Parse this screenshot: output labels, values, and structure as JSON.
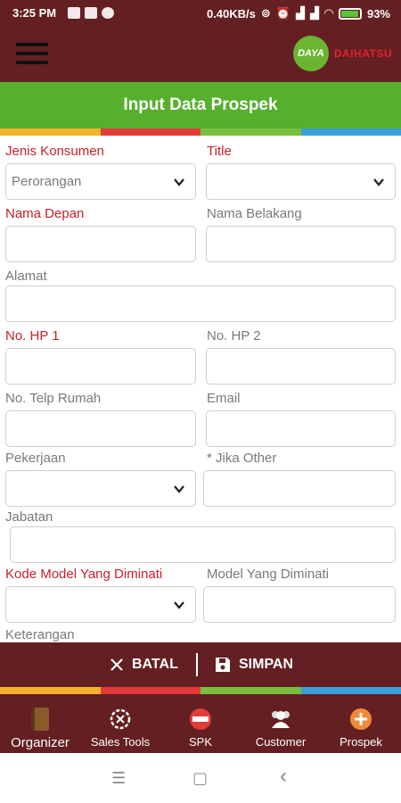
{
  "status": {
    "time": "3:25 PM",
    "net_speed": "0.40KB/s",
    "battery": "93%",
    "icons": [
      "notification-icon",
      "image-icon",
      "chat-icon",
      "sync-icon",
      "alarm-icon",
      "signal-icon",
      "signal-icon",
      "wifi-icon"
    ]
  },
  "appbar": {
    "menu_icon": "hamburger-icon",
    "logo_short": "DAYA",
    "logo_brand": "DAIHATSU"
  },
  "page": {
    "title": "Input Data Prospek"
  },
  "form": {
    "jenis_konsumen": {
      "label": "Jenis Konsumen",
      "value": "Perorangan",
      "required": true
    },
    "title": {
      "label": "Title",
      "value": "",
      "required": true
    },
    "nama_depan": {
      "label": "Nama Depan",
      "value": "",
      "required": true
    },
    "nama_belakang": {
      "label": "Nama Belakang",
      "value": ""
    },
    "alamat": {
      "label": "Alamat",
      "value": ""
    },
    "no_hp1": {
      "label": "No. HP 1",
      "value": "",
      "required": true
    },
    "no_hp2": {
      "label": "No. HP 2",
      "value": ""
    },
    "no_telp_rumah": {
      "label": "No. Telp Rumah",
      "value": ""
    },
    "email": {
      "label": "Email",
      "value": ""
    },
    "pekerjaan": {
      "label": "Pekerjaan",
      "value": ""
    },
    "jika_other": {
      "label": "* Jika Other",
      "value": ""
    },
    "jabatan": {
      "label": "Jabatan",
      "value": ""
    },
    "kode_model": {
      "label": "Kode Model Yang Diminati",
      "value": "",
      "required": true
    },
    "model": {
      "label": "Model Yang Diminati",
      "value": ""
    },
    "keterangan": {
      "label": "Keterangan"
    }
  },
  "actions": {
    "cancel_label": "BATAL",
    "save_label": "SIMPAN"
  },
  "bottom_nav": [
    {
      "label": "Organizer",
      "icon": "book-icon"
    },
    {
      "label": "Sales Tools",
      "icon": "gear-icon"
    },
    {
      "label": "SPK",
      "icon": "spk-badge-icon"
    },
    {
      "label": "Customer",
      "icon": "people-icon"
    },
    {
      "label": "Prospek",
      "icon": "add-circle-icon"
    }
  ],
  "system_nav": {
    "menu": "☰",
    "home": "▢",
    "back": "‹"
  },
  "colors": {
    "primary_maroon": "#641f22",
    "title_green": "#56b02d",
    "required_red": "#c8202a",
    "stripe_yellow": "#f4b32a",
    "stripe_red": "#e33b39",
    "stripe_green": "#78be3f",
    "stripe_blue": "#3a9fdb"
  }
}
